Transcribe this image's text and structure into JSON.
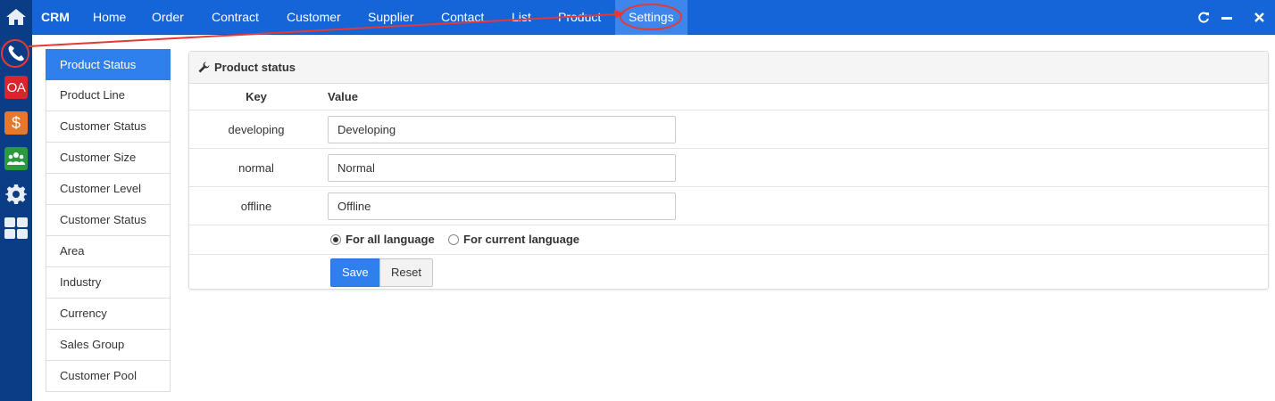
{
  "navbar": {
    "brand": "CRM",
    "items": [
      {
        "label": "Home"
      },
      {
        "label": "Order"
      },
      {
        "label": "Contract"
      },
      {
        "label": "Customer"
      },
      {
        "label": "Supplier"
      },
      {
        "label": "Contact"
      },
      {
        "label": "List"
      },
      {
        "label": "Product"
      },
      {
        "label": "Settings",
        "active": true
      }
    ],
    "window_controls": [
      "refresh-icon",
      "minimize-icon",
      "close-icon"
    ]
  },
  "dock": {
    "items": [
      {
        "icon": "home-icon"
      },
      {
        "icon": "phone-icon"
      },
      {
        "icon": "oa-icon",
        "label": "OA"
      },
      {
        "icon": "dollar-icon",
        "label": "$"
      },
      {
        "icon": "users-icon"
      },
      {
        "icon": "gear-icon"
      },
      {
        "icon": "grid-icon"
      }
    ]
  },
  "sidebar": {
    "items": [
      {
        "label": "Product Status",
        "active": true
      },
      {
        "label": "Product Line"
      },
      {
        "label": "Customer Status"
      },
      {
        "label": "Customer Size"
      },
      {
        "label": "Customer Level"
      },
      {
        "label": "Customer Status"
      },
      {
        "label": "Area"
      },
      {
        "label": "Industry"
      },
      {
        "label": "Currency"
      },
      {
        "label": "Sales Group"
      },
      {
        "label": "Customer Pool"
      }
    ]
  },
  "panel": {
    "title": "Product status",
    "title_icon": "wrench-icon",
    "headers": {
      "key": "Key",
      "value": "Value"
    },
    "rows": [
      {
        "key": "developing",
        "value": "Developing"
      },
      {
        "key": "normal",
        "value": "Normal"
      },
      {
        "key": "offline",
        "value": "Offline"
      }
    ],
    "language_options": [
      {
        "label": "For all language",
        "selected": true
      },
      {
        "label": "For current language",
        "selected": false
      }
    ],
    "buttons": {
      "save": "Save",
      "reset": "Reset"
    }
  },
  "colors": {
    "navbar": "#1565d8",
    "dock": "#0b3d86",
    "active": "#2f80ec",
    "annotation": "#e53935"
  }
}
